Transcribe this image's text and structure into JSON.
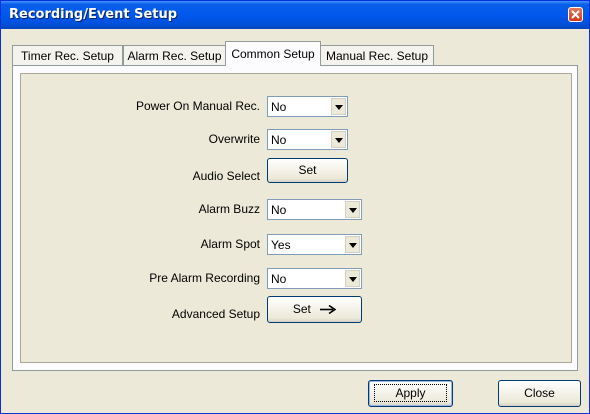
{
  "window": {
    "title": "Recording/Event Setup"
  },
  "tabs": [
    {
      "label": "Timer Rec. Setup",
      "active": false
    },
    {
      "label": "Alarm Rec. Setup",
      "active": false
    },
    {
      "label": "Common Setup",
      "active": true
    },
    {
      "label": "Manual Rec. Setup",
      "active": false
    }
  ],
  "settings": {
    "power_on_manual_rec": {
      "label": "Power On Manual Rec.",
      "value": "No"
    },
    "overwrite": {
      "label": "Overwrite",
      "value": "No"
    },
    "audio_select": {
      "label": "Audio Select",
      "button": "Set"
    },
    "alarm_buzz": {
      "label": "Alarm Buzz",
      "value": "No"
    },
    "alarm_spot": {
      "label": "Alarm Spot",
      "value": "Yes"
    },
    "pre_alarm_recording": {
      "label": "Pre Alarm Recording",
      "value": "No"
    },
    "advanced_setup": {
      "label": "Advanced Setup",
      "button": "Set"
    }
  },
  "footer": {
    "apply_label": "Apply",
    "close_label": "Close"
  },
  "icons": {
    "close": "close-icon",
    "dropdown": "chevron-down-icon",
    "arrow": "arrow-right-icon"
  },
  "colors": {
    "titlebar": "#0058ee",
    "window_bg": "#ece9d8",
    "close_button": "#d2391d"
  }
}
